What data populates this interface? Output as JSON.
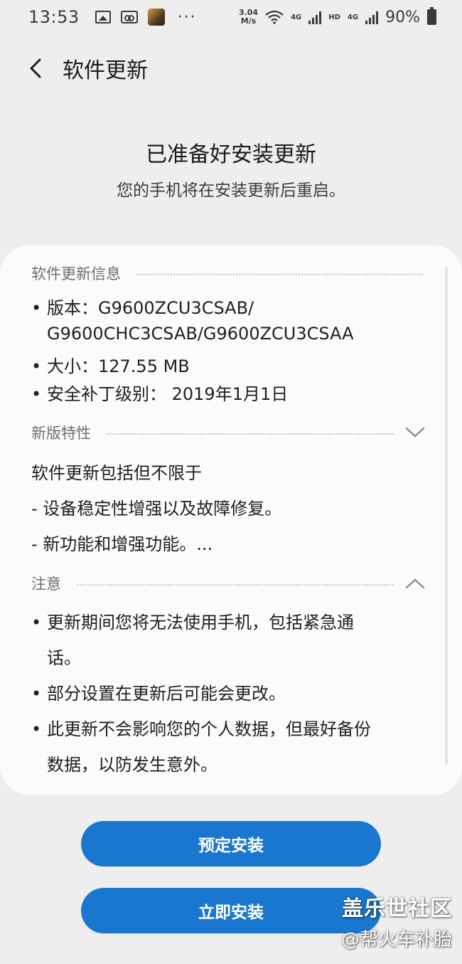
{
  "status_bar": {
    "time": "13:53",
    "more": "···",
    "net_speed_value": "3.04",
    "net_speed_unit": "M/s",
    "network_1": "4G",
    "hd": "HD",
    "network_2": "4G",
    "battery": "90%",
    "icons": [
      "image-icon",
      "cassette-icon",
      "game-app-icon",
      "wifi-icon",
      "signal-icon",
      "battery-charging-icon"
    ]
  },
  "header": {
    "title": "软件更新",
    "back_icon": "chevron-left-icon"
  },
  "intro": {
    "title": "已准备好安装更新",
    "subtitle": "您的手机将在安装更新后重启。"
  },
  "card": {
    "info": {
      "title": "软件更新信息",
      "version_line1": "版本：G9600ZCU3CSAB/",
      "version_line2": "G9600CHC3CSAB/G9600ZCU3CSAA",
      "size": "大小：127.55 MB",
      "security_patch": "安全补丁级别： 2019年1月1日"
    },
    "features": {
      "title": "新版特性",
      "state": "collapsed",
      "intro": "软件更新包括但不限于",
      "item1": "- 设备稳定性增强以及故障修复。",
      "item2": "- 新功能和增强功能。..."
    },
    "notes": {
      "title": "注意",
      "state": "expanded",
      "item1_line1": "更新期间您将无法使用手机，包括紧急通",
      "item1_line2": "话。",
      "item2": "部分设置在更新后可能会更改。",
      "item3_line1": "此更新不会影响您的个人数据，但最好备份",
      "item3_line2": "数据，以防发生意外。"
    },
    "bullet": "•"
  },
  "buttons": {
    "schedule": "预定安装",
    "install_now": "立即安装"
  },
  "watermark": {
    "main": "盖乐世社区",
    "sub": "@帮火车补胎"
  },
  "colors": {
    "background": "#eeeeee",
    "card": "#fbfbfb",
    "accent": "#1a77cf"
  }
}
